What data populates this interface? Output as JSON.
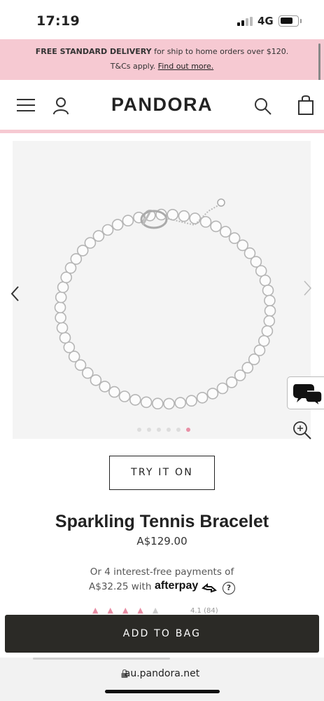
{
  "status_bar": {
    "time": "17:19",
    "network": "4G"
  },
  "promo": {
    "bold_text": "FREE STANDARD DELIVERY",
    "text": " for ship to home orders over $120.",
    "terms": "T&Cs apply.",
    "link": "Find out more."
  },
  "header": {
    "logo": "PANDORA"
  },
  "gallery": {
    "dot_count": 6,
    "active_dot": 5
  },
  "product": {
    "try_label": "TRY IT ON",
    "title": "Sparkling Tennis Bracelet",
    "price": "A$129.00",
    "afterpay_line1": "Or 4 interest-free payments of",
    "afterpay_amount": "A$32.25 with",
    "afterpay_brand": "afterpay",
    "info_glyph": "?",
    "rating_stars": 4,
    "review_count": "4.1 (84)",
    "add_label": "ADD TO BAG"
  },
  "browser": {
    "url": "au.pandora.net"
  },
  "colors": {
    "accent_pink": "#f6c9d2",
    "dark_button": "#2b2a26",
    "dot_active": "#e88fa5"
  },
  "icons": [
    "menu-icon",
    "user-icon",
    "search-icon",
    "bag-icon",
    "chevron-left-icon",
    "chevron-right-icon",
    "chat-icon",
    "zoom-icon",
    "info-icon",
    "lock-icon"
  ]
}
